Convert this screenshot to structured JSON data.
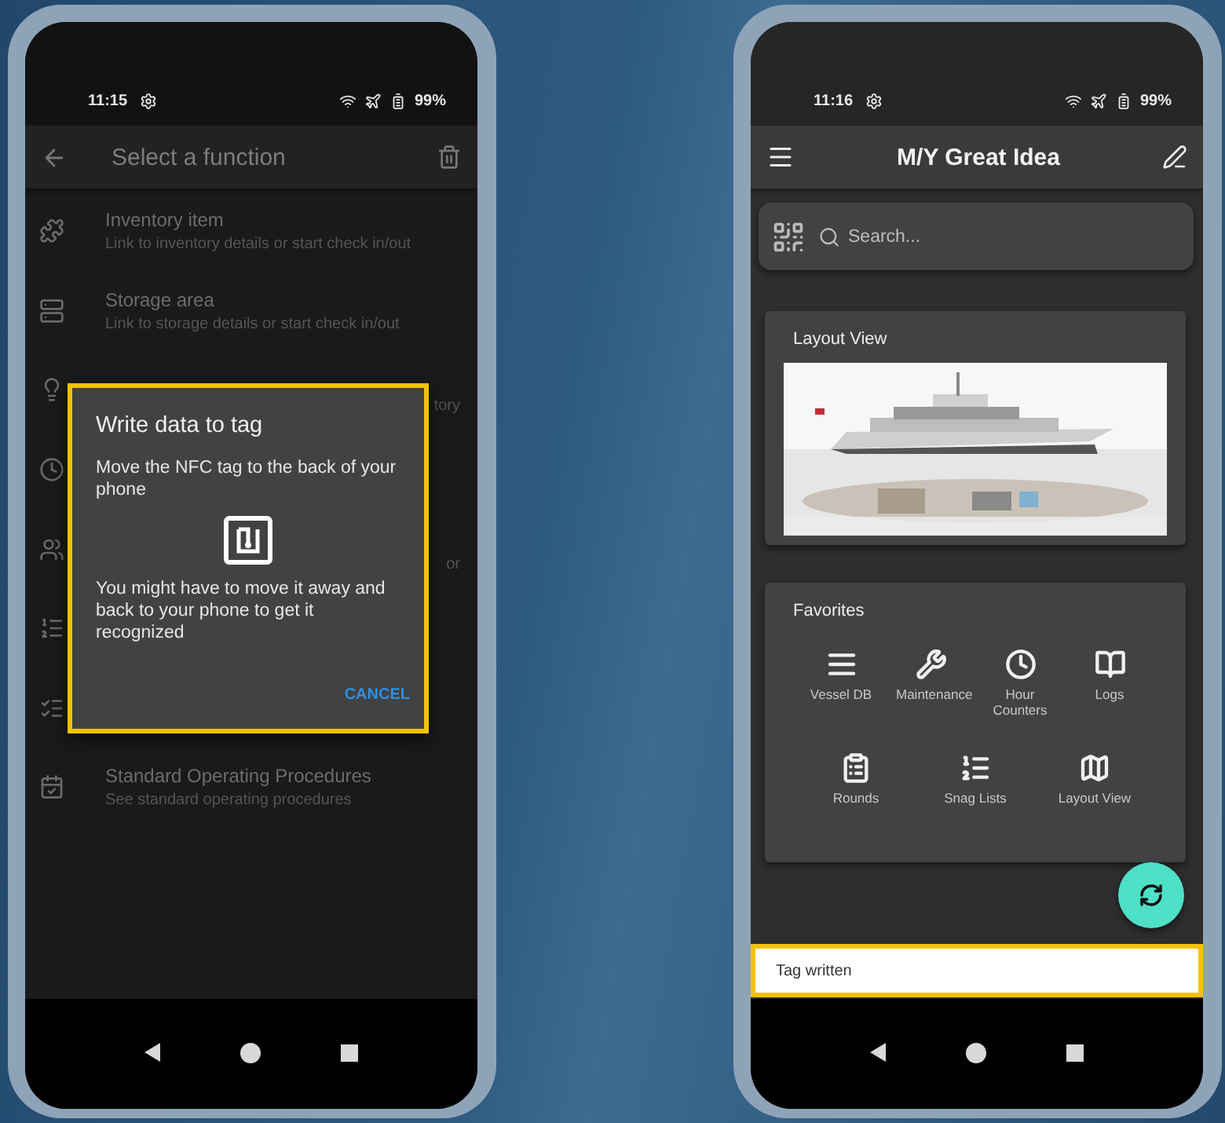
{
  "phones": [
    {
      "kind": "function-select",
      "status": {
        "time": "11:15",
        "battery": "99%"
      },
      "appbar": {
        "title": "Select a function"
      },
      "items": [
        {
          "kind": "entry",
          "title": "Inventory item",
          "subtitle": "Link to inventory details or start check in/out"
        },
        {
          "kind": "entry",
          "title": "Storage area",
          "subtitle": "Link to storage details or start check in/out"
        },
        {
          "kind": "covered",
          "fragment": "tory"
        },
        {
          "kind": "covered"
        },
        {
          "kind": "covered",
          "fragment": "or"
        },
        {
          "kind": "covered"
        },
        {
          "kind": "covered"
        },
        {
          "kind": "entry",
          "title": "Standard Operating Procedures",
          "subtitle": "See standard operating procedures"
        }
      ],
      "dialog": {
        "title": "Write data to tag",
        "message": "Move the NFC tag to the back of your phone",
        "hint": "You might have to move it away and back to your phone to get it recognized",
        "button": "CANCEL"
      }
    },
    {
      "kind": "home",
      "status": {
        "time": "11:16",
        "battery": "99%"
      },
      "appbar": {
        "title": "M/Y Great Idea"
      },
      "search": {
        "placeholder": "Search..."
      },
      "layout_card": {
        "title": "Layout View"
      },
      "favorites": {
        "title": "Favorites",
        "items": [
          {
            "label": "Vessel DB"
          },
          {
            "label": "Maintenance"
          },
          {
            "label": "Hour Counters"
          },
          {
            "label": "Logs"
          },
          {
            "label": "Rounds"
          },
          {
            "label": "Snag Lists"
          },
          {
            "label": "Layout View"
          }
        ]
      },
      "snackbar": {
        "text": "Tag written"
      }
    }
  ]
}
